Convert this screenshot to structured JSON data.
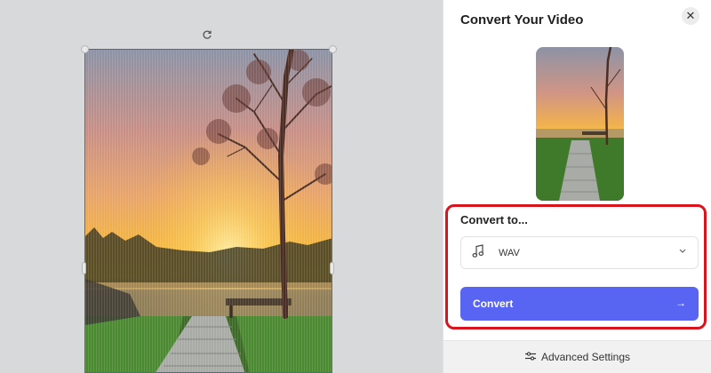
{
  "panel": {
    "title": "Convert Your Video",
    "close_icon": "close-icon",
    "convert_to_label": "Convert to...",
    "format_select": {
      "icon": "music-note-icon",
      "value": "WAV"
    },
    "convert_button": {
      "label": "Convert",
      "icon": "arrow-right-icon"
    },
    "advanced_settings": {
      "label": "Advanced Settings",
      "icon": "sliders-icon"
    }
  },
  "canvas": {
    "rotate_icon": "rotate-icon",
    "image_description_icon": "sunset-lake-path-image"
  },
  "colors": {
    "accent": "#5865f2",
    "highlight": "#d9141d",
    "selection_border": "#3c6fa0"
  }
}
